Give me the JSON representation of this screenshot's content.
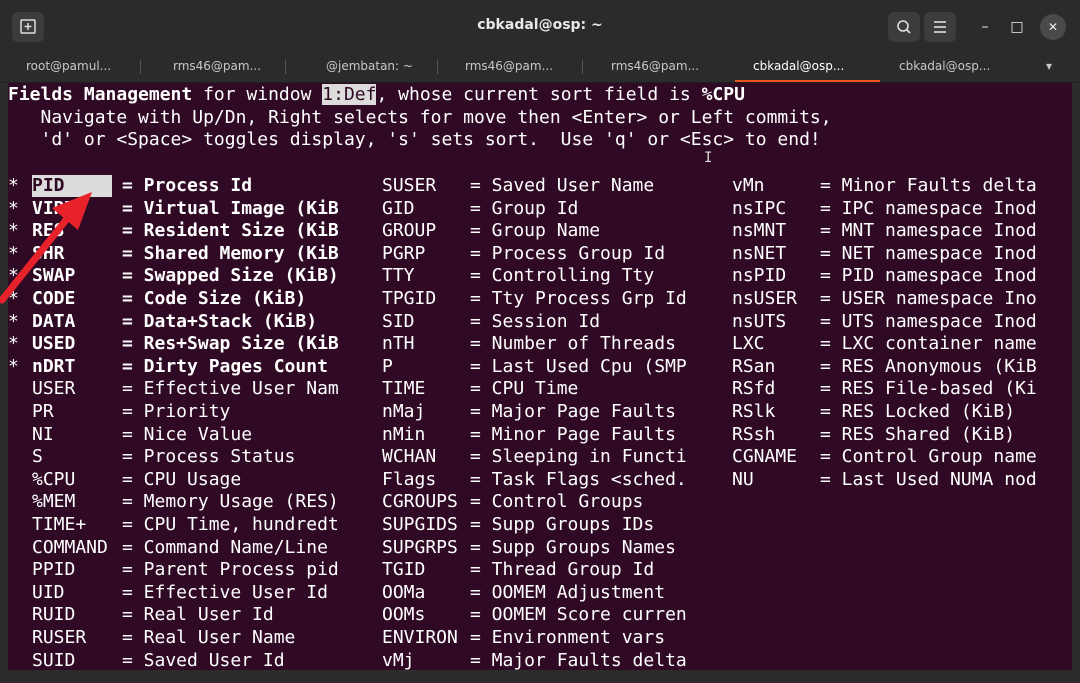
{
  "window": {
    "title": "cbkadal@osp: ~",
    "new_tab_icon": "new-tab-icon",
    "search_icon": "search-icon",
    "menu_icon": "hamburger-menu-icon",
    "minimize_glyph": "–",
    "maximize_glyph": "□",
    "close_glyph": "✕"
  },
  "tabs": [
    {
      "label": "root@pamul..."
    },
    {
      "label": "rms46@pam..."
    },
    {
      "label": "@jembatan: ~"
    },
    {
      "label": "rms46@pam..."
    },
    {
      "label": "rms46@pam..."
    },
    {
      "label": "cbkadal@osp...",
      "active": true
    },
    {
      "label": "cbkadal@osp..."
    }
  ],
  "tab_dropdown_glyph": "▾",
  "colors": {
    "terminal_bg": "#300a24",
    "accent": "#e95420",
    "arrow": "#e8222a"
  },
  "header": {
    "line1_prefix": "Fields Management",
    "line1_mid": " for window ",
    "line1_window": "1:Def",
    "line1_after": ", whose current sort field is ",
    "line1_sort": "%CPU",
    "line2": "   Navigate with Up/Dn, Right selects for move then <Enter> or Left commits,",
    "line3": "   'd' or <Space> toggles display, 's' sets sort.  Use 'q' or <Esc> to end!"
  },
  "columns": [
    {
      "rows": [
        {
          "mark": "*",
          "field": "PID",
          "desc": "= Process Id",
          "on": true,
          "selected": true
        },
        {
          "mark": "*",
          "field": "VIRT",
          "desc": "= Virtual Image (KiB",
          "on": true
        },
        {
          "mark": "*",
          "field": "RES",
          "desc": "= Resident Size (KiB",
          "on": true
        },
        {
          "mark": "*",
          "field": "SHR",
          "desc": "= Shared Memory (KiB",
          "on": true
        },
        {
          "mark": "*",
          "field": "SWAP",
          "desc": "= Swapped Size (KiB)",
          "on": true
        },
        {
          "mark": "*",
          "field": "CODE",
          "desc": "= Code Size (KiB)",
          "on": true
        },
        {
          "mark": "*",
          "field": "DATA",
          "desc": "= Data+Stack (KiB)",
          "on": true
        },
        {
          "mark": "*",
          "field": "USED",
          "desc": "= Res+Swap Size (KiB",
          "on": true
        },
        {
          "mark": "*",
          "field": "nDRT",
          "desc": "= Dirty Pages Count",
          "on": true
        },
        {
          "mark": " ",
          "field": "USER",
          "desc": "= Effective User Nam"
        },
        {
          "mark": " ",
          "field": "PR",
          "desc": "= Priority"
        },
        {
          "mark": " ",
          "field": "NI",
          "desc": "= Nice Value"
        },
        {
          "mark": " ",
          "field": "S",
          "desc": "= Process Status"
        },
        {
          "mark": " ",
          "field": "%CPU",
          "desc": "= CPU Usage"
        },
        {
          "mark": " ",
          "field": "%MEM",
          "desc": "= Memory Usage (RES)"
        },
        {
          "mark": " ",
          "field": "TIME+",
          "desc": "= CPU Time, hundredt"
        },
        {
          "mark": " ",
          "field": "COMMAND",
          "desc": "= Command Name/Line"
        },
        {
          "mark": " ",
          "field": "PPID",
          "desc": "= Parent Process pid"
        },
        {
          "mark": " ",
          "field": "UID",
          "desc": "= Effective User Id"
        },
        {
          "mark": " ",
          "field": "RUID",
          "desc": "= Real User Id"
        },
        {
          "mark": " ",
          "field": "RUSER",
          "desc": "= Real User Name"
        },
        {
          "mark": " ",
          "field": "SUID",
          "desc": "= Saved User Id"
        }
      ]
    },
    {
      "rows": [
        {
          "field": "SUSER",
          "desc": "= Saved User Name"
        },
        {
          "field": "GID",
          "desc": "= Group Id"
        },
        {
          "field": "GROUP",
          "desc": "= Group Name"
        },
        {
          "field": "PGRP",
          "desc": "= Process Group Id"
        },
        {
          "field": "TTY",
          "desc": "= Controlling Tty"
        },
        {
          "field": "TPGID",
          "desc": "= Tty Process Grp Id"
        },
        {
          "field": "SID",
          "desc": "= Session Id"
        },
        {
          "field": "nTH",
          "desc": "= Number of Threads"
        },
        {
          "field": "P",
          "desc": "= Last Used Cpu (SMP"
        },
        {
          "field": "TIME",
          "desc": "= CPU Time"
        },
        {
          "field": "nMaj",
          "desc": "= Major Page Faults"
        },
        {
          "field": "nMin",
          "desc": "= Minor Page Faults"
        },
        {
          "field": "WCHAN",
          "desc": "= Sleeping in Functi"
        },
        {
          "field": "Flags",
          "desc": "= Task Flags <sched."
        },
        {
          "field": "CGROUPS",
          "desc": "= Control Groups"
        },
        {
          "field": "SUPGIDS",
          "desc": "= Supp Groups IDs"
        },
        {
          "field": "SUPGRPS",
          "desc": "= Supp Groups Names"
        },
        {
          "field": "TGID",
          "desc": "= Thread Group Id"
        },
        {
          "field": "OOMa",
          "desc": "= OOMEM Adjustment"
        },
        {
          "field": "OOMs",
          "desc": "= OOMEM Score curren"
        },
        {
          "field": "ENVIRON",
          "desc": "= Environment vars"
        },
        {
          "field": "vMj",
          "desc": "= Major Faults delta"
        }
      ]
    },
    {
      "rows": [
        {
          "field": "vMn",
          "desc": "= Minor Faults delta"
        },
        {
          "field": "nsIPC",
          "desc": "= IPC namespace Inod"
        },
        {
          "field": "nsMNT",
          "desc": "= MNT namespace Inod"
        },
        {
          "field": "nsNET",
          "desc": "= NET namespace Inod"
        },
        {
          "field": "nsPID",
          "desc": "= PID namespace Inod"
        },
        {
          "field": "nsUSER",
          "desc": "= USER namespace Ino"
        },
        {
          "field": "nsUTS",
          "desc": "= UTS namespace Inod"
        },
        {
          "field": "LXC",
          "desc": "= LXC container name"
        },
        {
          "field": "RSan",
          "desc": "= RES Anonymous (KiB"
        },
        {
          "field": "RSfd",
          "desc": "= RES File-based (Ki"
        },
        {
          "field": "RSlk",
          "desc": "= RES Locked (KiB)"
        },
        {
          "field": "RSsh",
          "desc": "= RES Shared (KiB)"
        },
        {
          "field": "CGNAME",
          "desc": "= Control Group name"
        },
        {
          "field": "NU",
          "desc": "= Last Used NUMA nod"
        }
      ]
    }
  ],
  "cursor_glyph": "I"
}
